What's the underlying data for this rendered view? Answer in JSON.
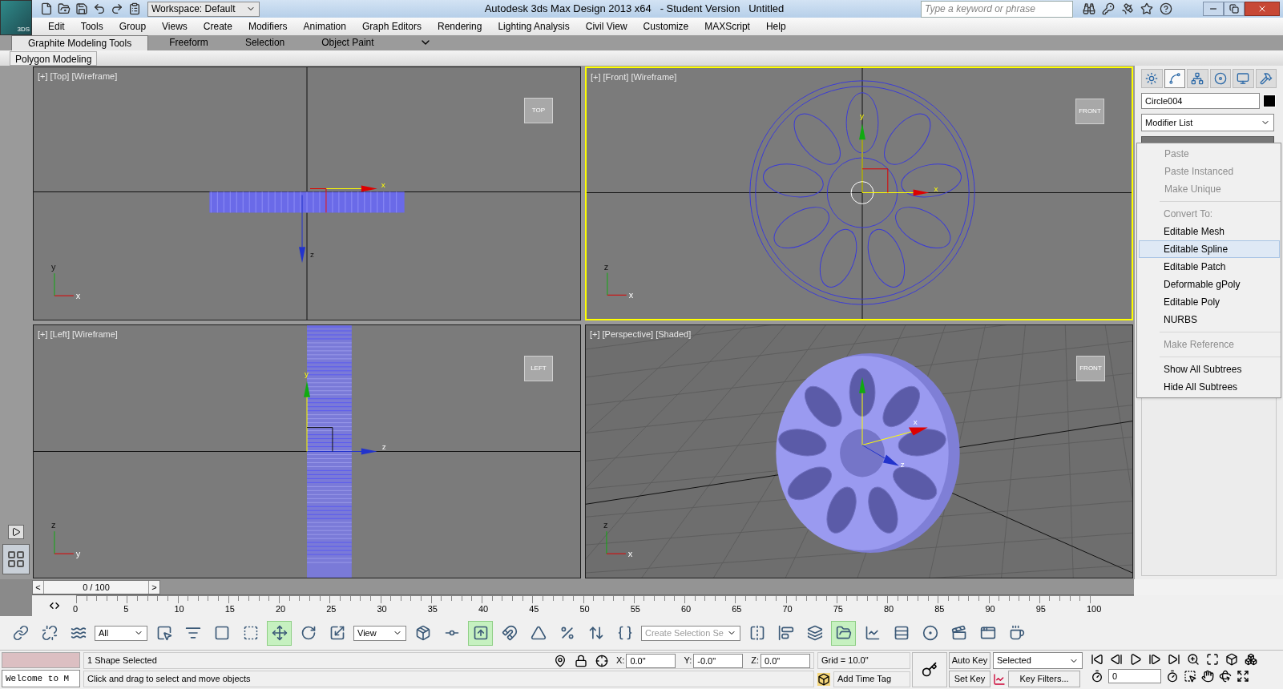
{
  "title_bar": {
    "logo": "3DS",
    "workspace": "Workspace: Default",
    "title": "Autodesk 3ds Max Design 2013 x64   - Student Version   Untitled",
    "search_placeholder": "Type a keyword or phrase"
  },
  "menu": [
    "Edit",
    "Tools",
    "Group",
    "Views",
    "Create",
    "Modifiers",
    "Animation",
    "Graph Editors",
    "Rendering",
    "Lighting Analysis",
    "Civil View",
    "Customize",
    "MAXScript",
    "Help"
  ],
  "ribbon_tabs": [
    {
      "label": "Graphite Modeling Tools",
      "selected": true
    },
    {
      "label": "Freeform",
      "selected": false
    },
    {
      "label": "Selection",
      "selected": false
    },
    {
      "label": "Object Paint",
      "selected": false
    }
  ],
  "ribbon_panel": "Polygon Modeling",
  "viewports": [
    {
      "label": "[+] [Top] [Wireframe]",
      "kind": "top",
      "active": false,
      "cube": "TOP",
      "gizmo_axes": [
        "x",
        "z"
      ],
      "tripod_axes": [
        "y",
        "x"
      ]
    },
    {
      "label": "[+] [Front] [Wireframe]",
      "kind": "front",
      "active": true,
      "cube": "FRONT",
      "gizmo_axes": [
        "x",
        "y"
      ],
      "tripod_axes": [
        "z",
        "x"
      ]
    },
    {
      "label": "[+] [Left] [Wireframe]",
      "kind": "left",
      "active": false,
      "cube": "LEFT",
      "gizmo_axes": [
        "z",
        "y"
      ],
      "tripod_axes": [
        "z",
        "y"
      ]
    },
    {
      "label": "[+] [Perspective] [Shaded]",
      "kind": "perspective",
      "active": false,
      "cube": "FRONT",
      "gizmo_axes": [
        "x",
        "z"
      ],
      "tripod_axes": [
        "z",
        "x"
      ]
    }
  ],
  "command_panel": {
    "tabs": [
      {
        "selected": false
      },
      {
        "selected": true
      },
      {
        "selected": false
      },
      {
        "selected": false
      },
      {
        "selected": false
      },
      {
        "selected": false
      }
    ],
    "object_name": "Circle004",
    "modifier_list": "Modifier List"
  },
  "context_menu": [
    [
      {
        "label": "Paste",
        "disabled": true,
        "selected": false
      },
      {
        "label": "Paste Instanced",
        "disabled": true,
        "selected": false
      },
      {
        "label": "Make Unique",
        "disabled": true,
        "selected": false
      }
    ],
    [
      {
        "label": "Convert To:",
        "disabled": true,
        "selected": false
      },
      {
        "label": "Editable Mesh",
        "disabled": false,
        "selected": false
      },
      {
        "label": "Editable Spline",
        "disabled": false,
        "selected": true
      },
      {
        "label": "Editable Patch",
        "disabled": false,
        "selected": false
      },
      {
        "label": "Deformable gPoly",
        "disabled": false,
        "selected": false
      },
      {
        "label": "Editable Poly",
        "disabled": false,
        "selected": false
      },
      {
        "label": "NURBS",
        "disabled": false,
        "selected": false
      }
    ],
    [
      {
        "label": "Make Reference",
        "disabled": true,
        "selected": false
      }
    ],
    [
      {
        "label": "Show All Subtrees",
        "disabled": false,
        "selected": false
      },
      {
        "label": "Hide All Subtrees",
        "disabled": false,
        "selected": false
      }
    ]
  ],
  "timeline": {
    "prev": "<",
    "next": ">",
    "slider": "0 / 100",
    "level": 0,
    "ticks": [
      "0",
      "5",
      "10",
      "15",
      "20",
      "25",
      "30",
      "35",
      "40",
      "45",
      "50",
      "55",
      "60",
      "65",
      "70",
      "75",
      "80",
      "85",
      "90",
      "95",
      "100"
    ]
  },
  "toolbar": [
    {
      "kind": "icon",
      "selected": false
    },
    {
      "kind": "icon",
      "selected": false
    },
    {
      "kind": "icon",
      "selected": false
    },
    {
      "kind": "dropdown",
      "value": "All"
    },
    {
      "kind": "icon",
      "selected": false
    },
    {
      "kind": "icon",
      "selected": false
    },
    {
      "kind": "icon",
      "selected": false
    },
    {
      "kind": "icon",
      "selected": false
    },
    {
      "kind": "icon",
      "selected": true
    },
    {
      "kind": "icon",
      "selected": false
    },
    {
      "kind": "icon",
      "selected": false
    },
    {
      "kind": "dropdown",
      "value": "View"
    },
    {
      "kind": "icon",
      "selected": false
    },
    {
      "kind": "icon",
      "selected": false
    },
    {
      "kind": "icon",
      "selected": true
    },
    {
      "kind": "icon",
      "selected": false
    },
    {
      "kind": "icon",
      "selected": false
    },
    {
      "kind": "icon",
      "selected": false
    },
    {
      "kind": "icon",
      "selected": false
    },
    {
      "kind": "icon",
      "selected": false
    },
    {
      "kind": "combo",
      "placeholder": "Create Selection Se"
    },
    {
      "kind": "icon",
      "selected": false
    },
    {
      "kind": "icon",
      "selected": false
    },
    {
      "kind": "icon",
      "selected": false
    },
    {
      "kind": "icon",
      "selected": true
    },
    {
      "kind": "icon",
      "selected": false
    },
    {
      "kind": "icon",
      "selected": false
    },
    {
      "kind": "icon",
      "selected": false
    },
    {
      "kind": "icon",
      "selected": false
    },
    {
      "kind": "icon",
      "selected": false
    },
    {
      "kind": "icon",
      "selected": false
    }
  ],
  "status": {
    "listener": "Welcome to M",
    "prompt": "1 Shape Selected",
    "hint": "Click and drag to select and move objects",
    "coords": [
      {
        "label": "X:",
        "value": "0.0\""
      },
      {
        "label": "Y:",
        "value": "-0.0\""
      },
      {
        "label": "Z:",
        "value": "0.0\""
      }
    ],
    "grid": "Grid = 10.0\"",
    "time_tag": "Add Time Tag",
    "auto_key": "Auto Key",
    "set_key": "Set Key",
    "key_mode": "Selected",
    "key_filters": "Key Filters...",
    "frame": "0"
  }
}
